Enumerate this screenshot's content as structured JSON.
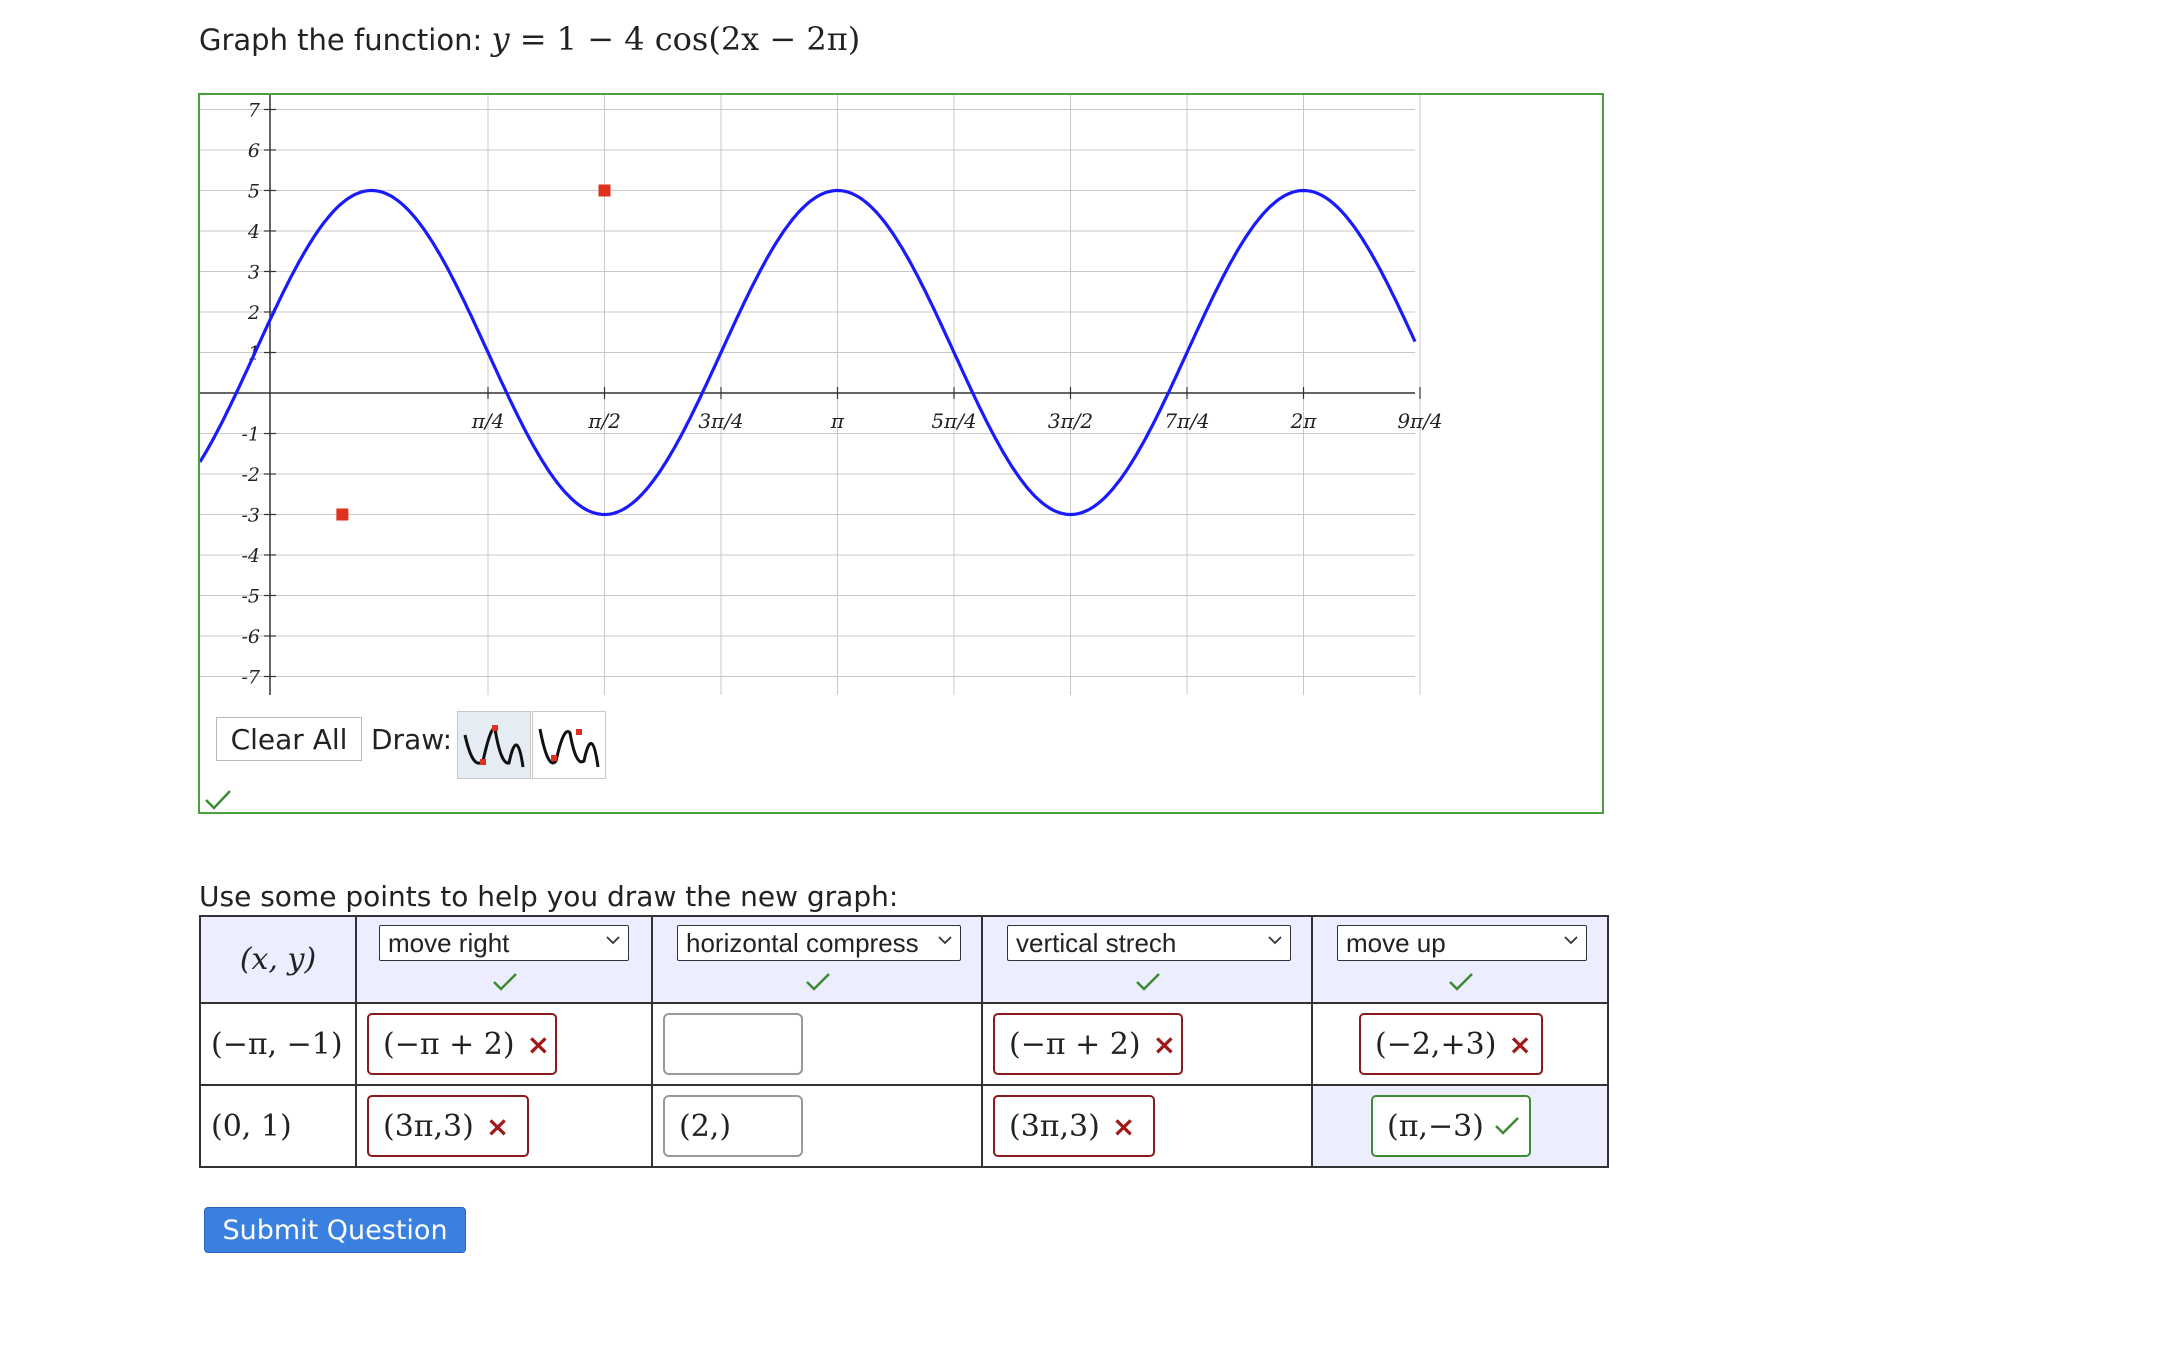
{
  "problem": {
    "prompt_label": "Graph the function:",
    "equation_lhs": "y",
    "equation_rhs": "= 1 − 4 cos(2x − 2π)"
  },
  "graph": {
    "y_tick_labels": [
      "7",
      "6",
      "5",
      "4",
      "3",
      "2",
      "1",
      "-1",
      "-2",
      "-3",
      "-4",
      "-5",
      "-6",
      "-7"
    ],
    "x_tick_labels": [
      "π/4",
      "π/2",
      "3π/4",
      "π",
      "5π/4",
      "3π/2",
      "7π/4",
      "2π",
      "9π/4"
    ],
    "curve": {
      "function": "1 - 4cos(2x - 2π)",
      "color": "#1a1aff"
    },
    "control_points": [
      {
        "x": "π/2",
        "y": 5
      },
      {
        "x": "-π/16 (approx)",
        "y": -3
      }
    ],
    "point_color": "#e0301e",
    "toolbar": {
      "clear_all_label": "Clear All",
      "draw_label": "Draw:"
    },
    "status": "correct"
  },
  "points_instruction": "Use some points to help you draw the new graph:",
  "table": {
    "xy_header": "(x, y)",
    "columns": [
      {
        "selected": "move right",
        "status": "correct"
      },
      {
        "selected": "horizontal compress",
        "status": "correct"
      },
      {
        "selected": "vertical strech",
        "status": "correct"
      },
      {
        "selected": "move up",
        "status": "correct"
      }
    ],
    "rows": [
      {
        "xy": "(−π, −1)",
        "cells": [
          {
            "value": "(−π + 2)",
            "status": "incorrect"
          },
          {
            "value": "",
            "status": "empty"
          },
          {
            "value": "(−π + 2)",
            "status": "incorrect"
          },
          {
            "value": "(−2,+3)",
            "status": "incorrect"
          }
        ]
      },
      {
        "xy": "(0, 1)",
        "cells": [
          {
            "value": "(3π,3)",
            "status": "incorrect"
          },
          {
            "value": "(2,)",
            "status": "empty"
          },
          {
            "value": "(3π,3)",
            "status": "incorrect"
          },
          {
            "value": "(π,−3)",
            "status": "correct"
          }
        ]
      }
    ],
    "incorrect_mark": "×"
  },
  "submit_label": "Submit Question",
  "colors": {
    "correct": "#3c8a32",
    "incorrect": "#a01818",
    "accent": "#3a80e0",
    "header_bg": "#eceeff"
  }
}
